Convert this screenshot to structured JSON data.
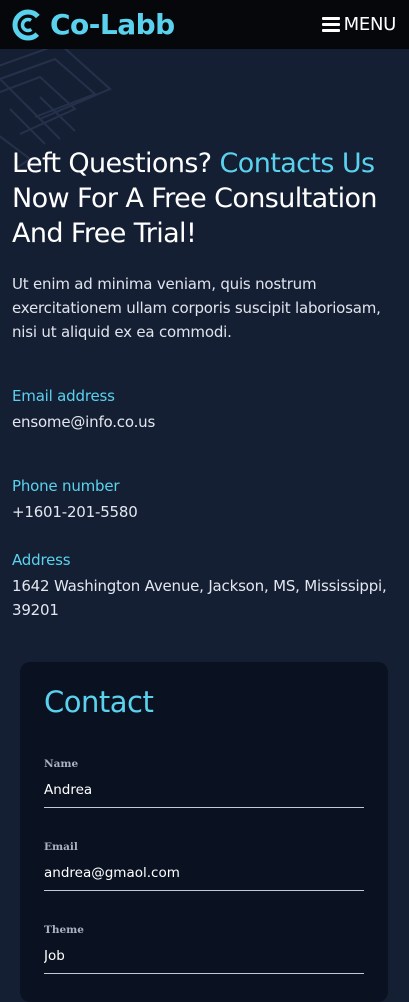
{
  "header": {
    "brand": "Co-Labb",
    "menu_label": "MENU"
  },
  "hero": {
    "headline_part1": "Left Questions?",
    "headline_highlight": "Contacts Us",
    "headline_part2": "Now For A Free Consultation And Free Trial!",
    "lead": "Ut enim ad minima veniam, quis nostrum exercitationem ullam corporis suscipit laboriosam, nisi ut aliquid ex ea commodi."
  },
  "contact_info": {
    "email_label": "Email address",
    "email_value": "ensome@info.co.us",
    "phone_label": "Phone number",
    "phone_value": "+1601-201-5580",
    "address_label": "Address",
    "address_value": "1642 Washington Avenue, Jackson, MS, Mississippi, 39201"
  },
  "form": {
    "title": "Contact",
    "fields": [
      {
        "label": "Name",
        "value": "Andrea"
      },
      {
        "label": "Email",
        "value": "andrea@gmaol.com"
      },
      {
        "label": "Theme",
        "value": "Job"
      }
    ]
  },
  "icons": {
    "logo": "co-labb-logo-icon",
    "menu": "hamburger-menu-icon"
  },
  "colors": {
    "accent": "#5ad2ee",
    "background": "#151f33",
    "header_background": "#05070b",
    "card_background": "#0a1222"
  }
}
